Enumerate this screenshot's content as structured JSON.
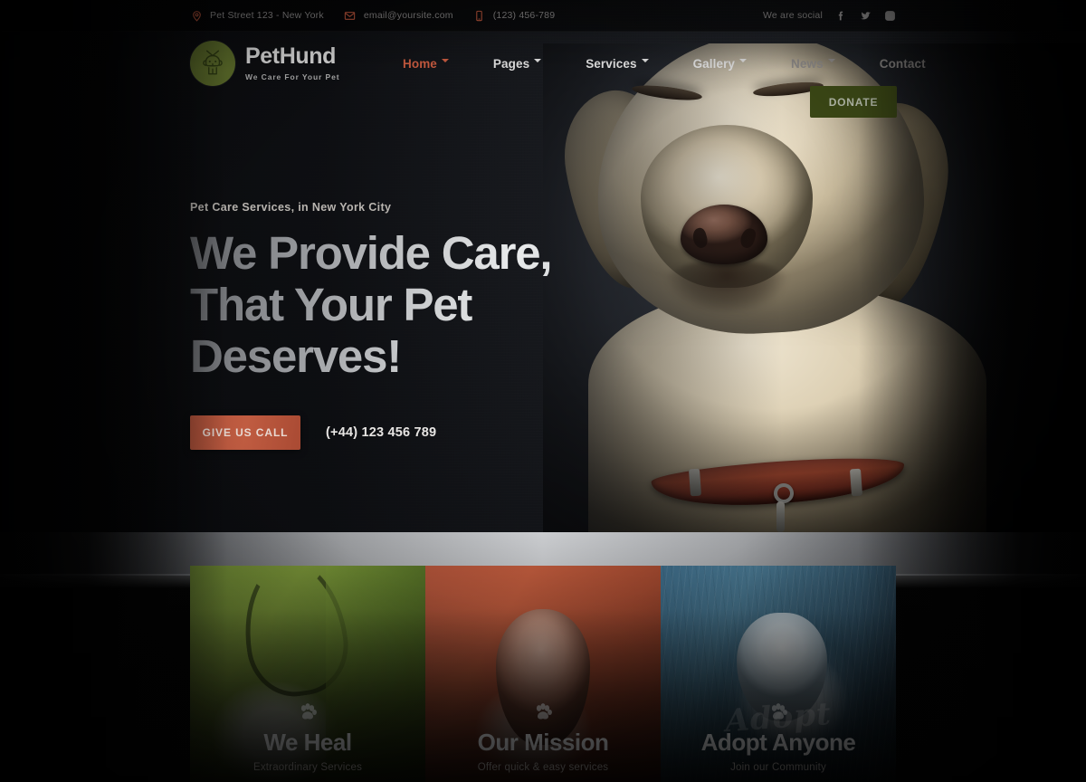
{
  "topbar": {
    "contacts": [
      {
        "icon": "location-pin-icon",
        "text": "Pet Street 123 - New York"
      },
      {
        "icon": "envelope-icon",
        "text": "email@yoursite.com"
      },
      {
        "icon": "mobile-phone-icon",
        "text": "(123) 456-789"
      }
    ],
    "social_label": "We are social",
    "social": [
      {
        "icon": "facebook-icon",
        "name": "Facebook"
      },
      {
        "icon": "twitter-icon",
        "name": "Twitter"
      },
      {
        "icon": "instagram-icon",
        "name": "Instagram"
      }
    ]
  },
  "header": {
    "logo": {
      "icon": "dog-badge-icon",
      "name": "PetHund",
      "tagline": "We Care For Your Pet"
    },
    "nav": [
      {
        "label": "Home",
        "has_dropdown": true,
        "active": true
      },
      {
        "label": "Pages",
        "has_dropdown": true,
        "active": false
      },
      {
        "label": "Services",
        "has_dropdown": true,
        "active": false
      },
      {
        "label": "Gallery",
        "has_dropdown": true,
        "active": false
      },
      {
        "label": "News",
        "has_dropdown": true,
        "active": false
      },
      {
        "label": "Contact",
        "has_dropdown": false,
        "active": false
      }
    ],
    "donate_label": "DONATE"
  },
  "hero": {
    "subtitle": "Pet Care Services, in New York City",
    "title_line1": "We Provide Care,",
    "title_line2": "That Your Pet",
    "title_line3": "Deserves!",
    "cta_label": "GIVE US CALL",
    "phone": "(+44) 123 456 789",
    "image_alt": "yellow-labrador-with-red-collar"
  },
  "cards": [
    {
      "title": "We Heal",
      "subtitle": "Extraordinary Services",
      "icon": "paw-icon",
      "accent": "#6f8a35",
      "script_overlay": ""
    },
    {
      "title": "Our Mission",
      "subtitle": "Offer quick & easy services",
      "icon": "paw-icon",
      "accent": "#b2543a",
      "script_overlay": ""
    },
    {
      "title": "Adopt Anyone",
      "subtitle": "Join our Community",
      "icon": "paw-icon",
      "accent": "#3d6a86",
      "script_overlay": "Adopt"
    }
  ],
  "colors": {
    "accent_orange": "#c4593e",
    "accent_green": "#5b6b2a",
    "donate_green": "#3d4a16",
    "hero_dark": "#15171b"
  }
}
